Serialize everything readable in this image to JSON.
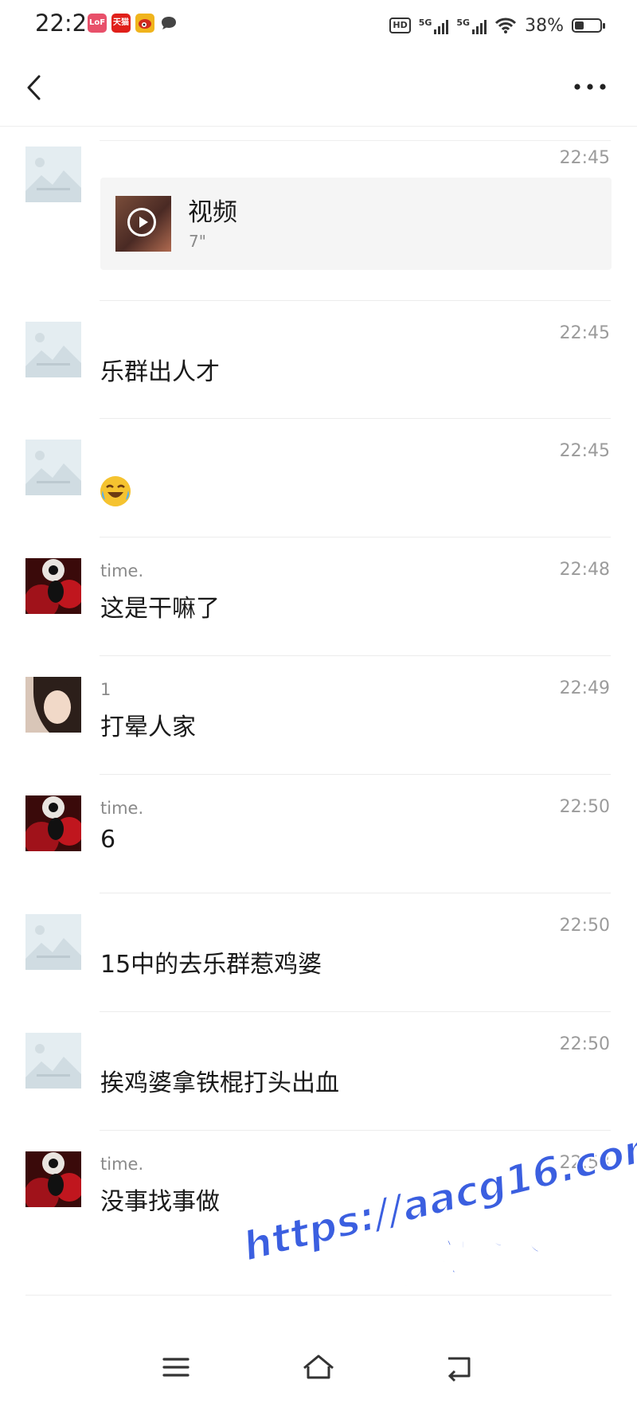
{
  "status_bar": {
    "time": "22:21",
    "apps": [
      {
        "icon": "lofter-icon",
        "label": "LoF",
        "color": "#e8506a"
      },
      {
        "icon": "tmall-icon",
        "label": "天猫",
        "color": "#e0201a"
      },
      {
        "icon": "weibo-icon",
        "label": "",
        "color": "#f0b41c"
      },
      {
        "icon": "chat-bubble-icon",
        "label": "",
        "color": "#444444"
      }
    ],
    "hd_label": "HD",
    "signal_label_1": "5G",
    "signal_label_2": "5G",
    "battery": "38%",
    "battery_level": 0.38
  },
  "nav": {
    "back_icon": "back-arrow-icon",
    "more_icon": "more-dots-icon"
  },
  "messages": [
    {
      "avatar": "placeholder",
      "sender": "",
      "time": "22:45",
      "type": "video",
      "video_title": "视频",
      "video_duration": "7\""
    },
    {
      "avatar": "placeholder",
      "sender": "",
      "time": "22:45",
      "type": "text",
      "text": "乐群出人才"
    },
    {
      "avatar": "placeholder",
      "sender": "",
      "time": "22:45",
      "type": "emoji",
      "emoji": "laughing-crying-emoji"
    },
    {
      "avatar": "red-dark",
      "sender": "time.",
      "time": "22:48",
      "type": "text",
      "text": "这是干嘛了"
    },
    {
      "avatar": "girl-photo",
      "sender": "1",
      "time": "22:49",
      "type": "text",
      "text": "打晕人家"
    },
    {
      "avatar": "red-dark",
      "sender": "time.",
      "time": "22:50",
      "type": "text",
      "text": "6"
    },
    {
      "avatar": "placeholder",
      "sender": "",
      "time": "22:50",
      "type": "text",
      "text": "15中的去乐群惹鸡婆"
    },
    {
      "avatar": "placeholder",
      "sender": "",
      "time": "22:50",
      "type": "text",
      "text": "挨鸡婆拿铁棍打头出血"
    },
    {
      "avatar": "red-dark",
      "sender": "time.",
      "time": "22:53",
      "type": "text",
      "text": "没事找事做"
    }
  ],
  "bottom_nav": {
    "menu_icon": "menu-icon",
    "home_icon": "home-icon",
    "back_icon": "back-return-icon"
  },
  "watermark": {
    "url": "https://aacg16.com",
    "subtitle": "看完整版",
    "color": "#3b5fe0"
  }
}
